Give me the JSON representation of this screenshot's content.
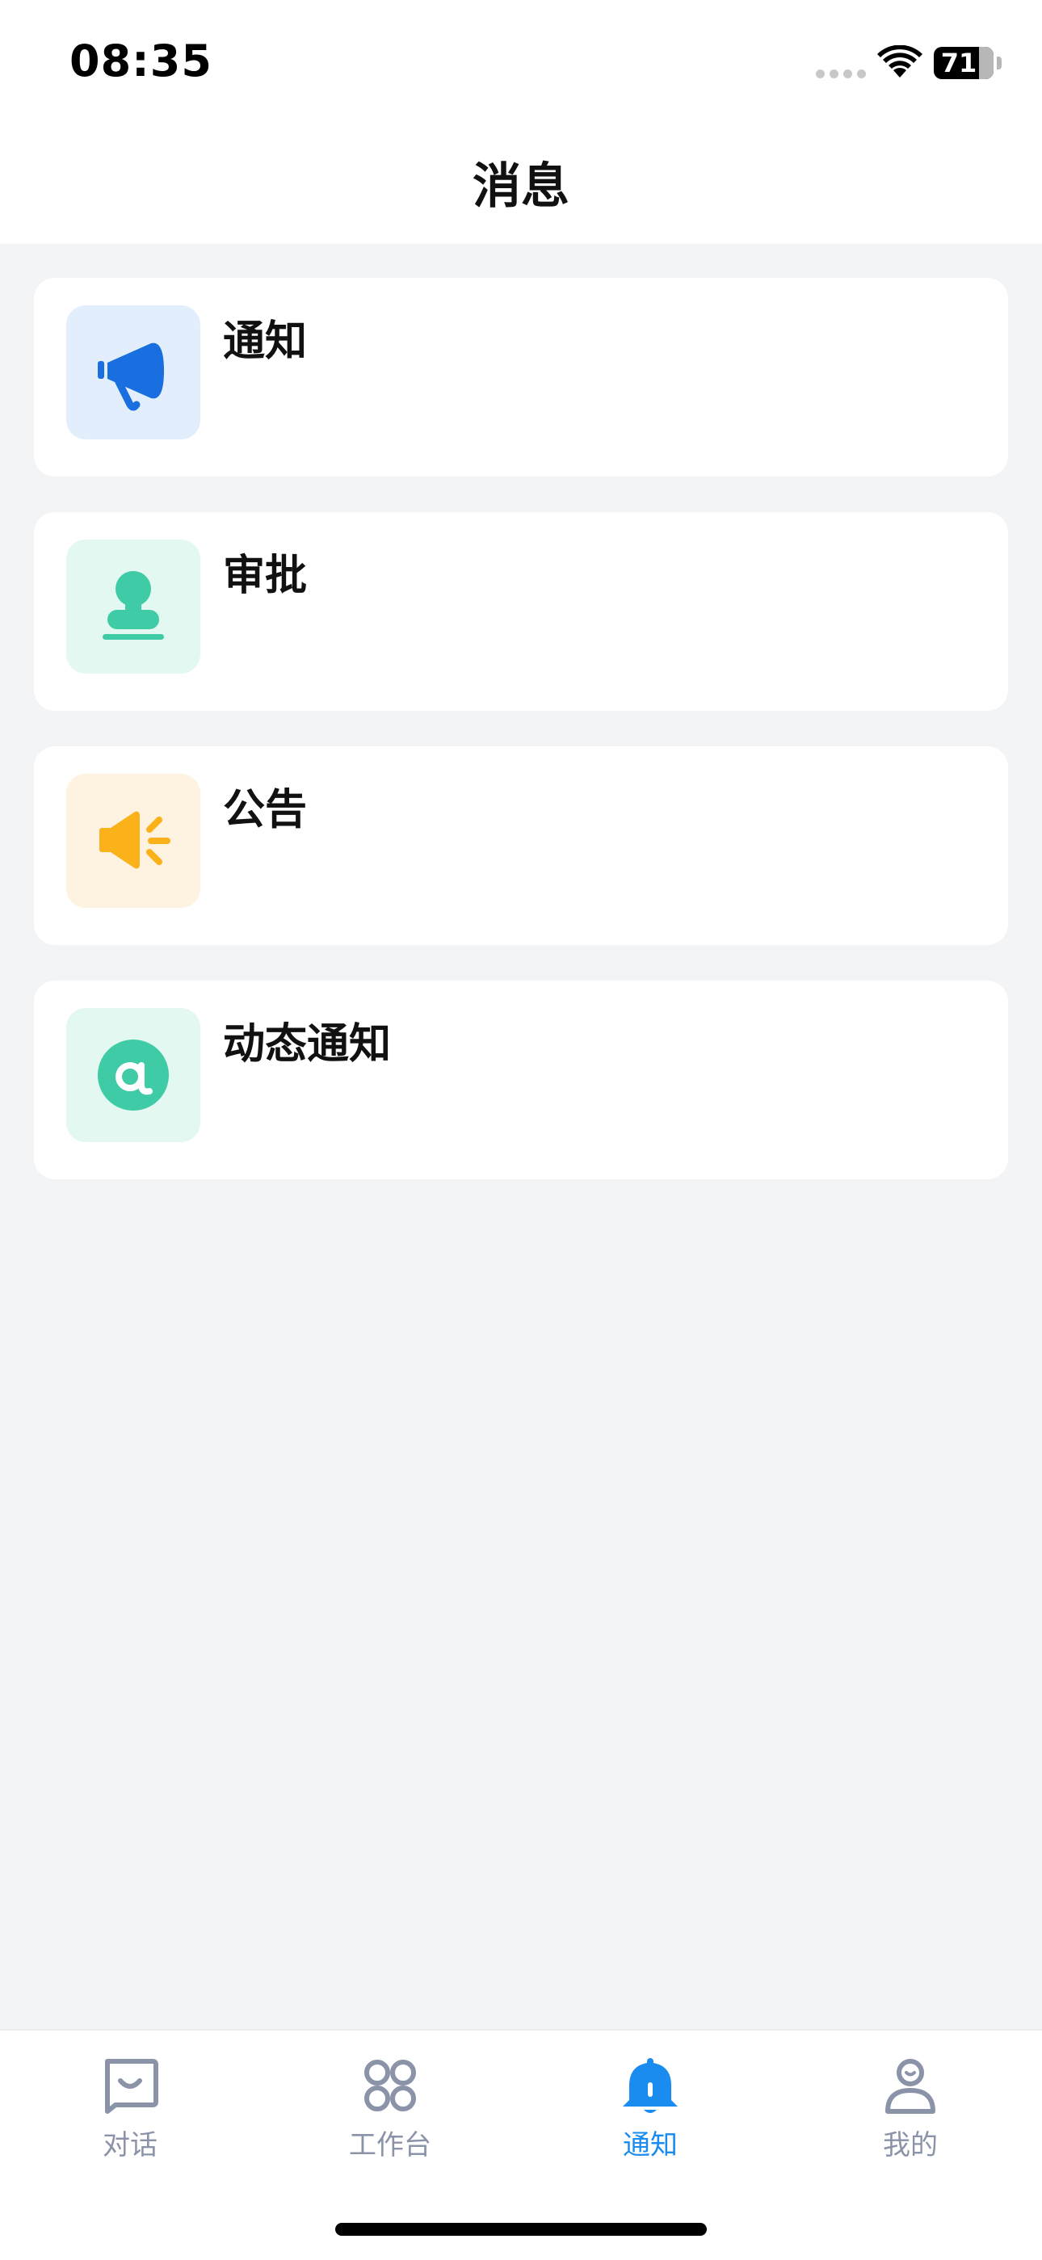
{
  "status_bar": {
    "time": "08:35",
    "battery": "71"
  },
  "header": {
    "title": "消息"
  },
  "items": [
    {
      "label": "通知",
      "icon": "megaphone-icon",
      "icon_color": "#1a6fe0",
      "icon_bg": "#e3eefc"
    },
    {
      "label": "审批",
      "icon": "stamp-icon",
      "icon_color": "#3ecba6",
      "icon_bg": "#e4f8f2"
    },
    {
      "label": "公告",
      "icon": "speaker-icon",
      "icon_color": "#fbb11a",
      "icon_bg": "#fef3e0"
    },
    {
      "label": "动态通知",
      "icon": "at-icon",
      "icon_color": "#3ecba6",
      "icon_bg": "#e4f8f2"
    }
  ],
  "tabbar": {
    "tabs": [
      {
        "label": "对话",
        "icon": "chat-icon"
      },
      {
        "label": "工作台",
        "icon": "grid-icon"
      },
      {
        "label": "通知",
        "icon": "bell-icon",
        "active": true
      },
      {
        "label": "我的",
        "icon": "user-icon"
      }
    ]
  },
  "colors": {
    "accent": "#1a8cf0",
    "inactive": "#8b93a8",
    "background": "#f3f4f6"
  }
}
